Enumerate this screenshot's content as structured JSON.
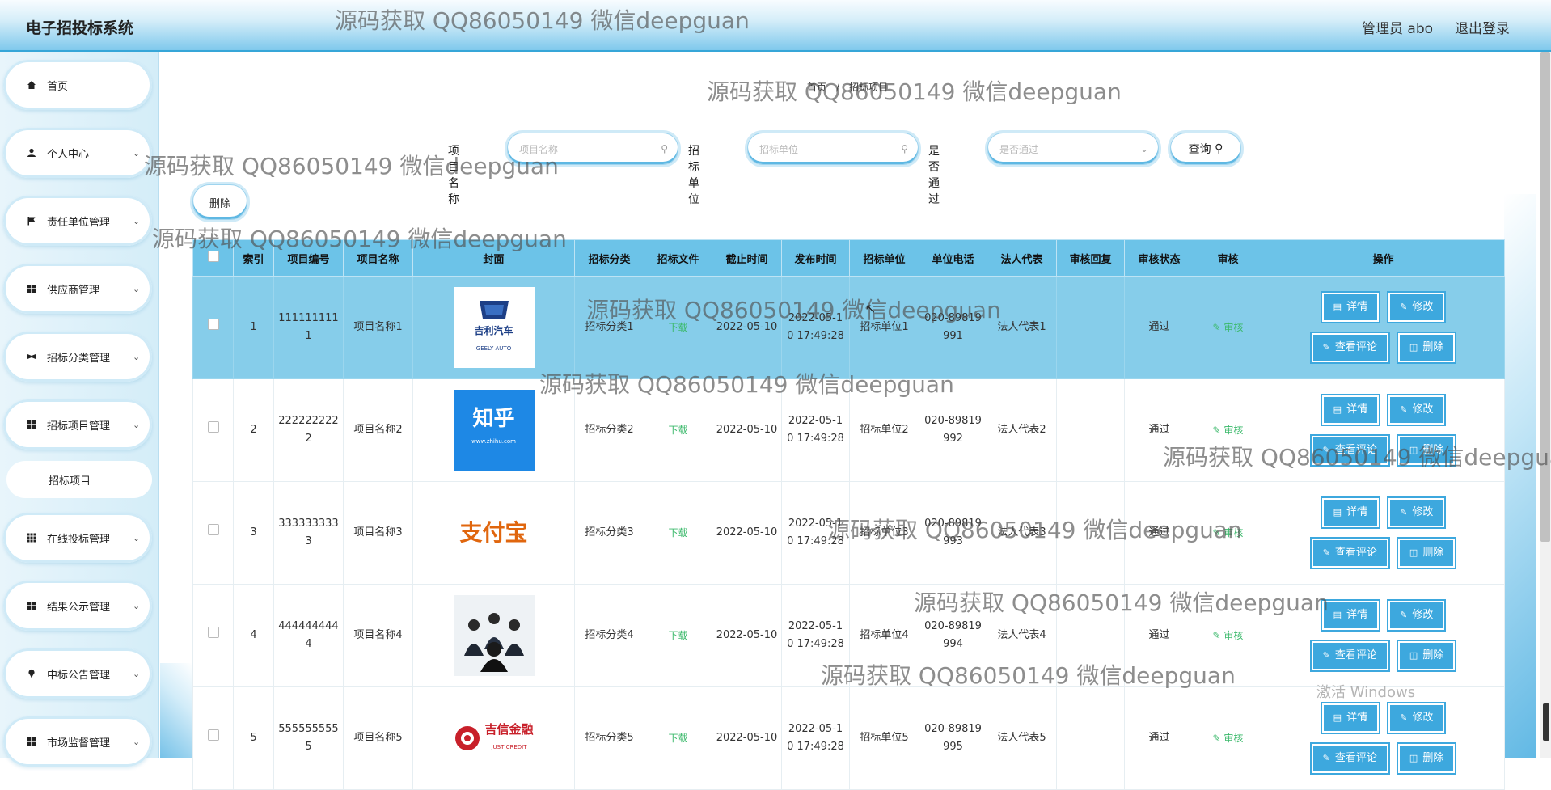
{
  "header": {
    "app_title": "电子招投标系统",
    "admin_text": "管理员 abo",
    "logout_label": "退出登录"
  },
  "sidebar": {
    "items": [
      {
        "label": "首页",
        "icon": "home-icon",
        "has_chevron": false
      },
      {
        "label": "个人中心",
        "icon": "user-icon",
        "has_chevron": true
      },
      {
        "label": "责任单位管理",
        "icon": "flag-icon",
        "has_chevron": true
      },
      {
        "label": "供应商管理",
        "icon": "grid-icon",
        "has_chevron": true
      },
      {
        "label": "招标分类管理",
        "icon": "ribbon-icon",
        "has_chevron": true
      },
      {
        "label": "招标项目管理",
        "icon": "grid-icon",
        "has_chevron": true
      },
      {
        "label": "在线投标管理",
        "icon": "apps-icon",
        "has_chevron": true
      },
      {
        "label": "结果公示管理",
        "icon": "grid-icon",
        "has_chevron": true
      },
      {
        "label": "中标公告管理",
        "icon": "pin-icon",
        "has_chevron": true
      },
      {
        "label": "市场监督管理",
        "icon": "grid-icon",
        "has_chevron": true
      }
    ],
    "sub_item": {
      "label": "招标项目"
    }
  },
  "breadcrumb": {
    "home": "首页",
    "sep": "/",
    "current": "招标项目"
  },
  "search": {
    "name_label": "项目名称",
    "name_placeholder": "项目名称",
    "unit_label": "招标单位",
    "unit_placeholder": "招标单位",
    "pass_label": "是否通过",
    "pass_placeholder": "是否通过",
    "query_label": "查询"
  },
  "toolbar": {
    "delete_label": "删除"
  },
  "table": {
    "headers": [
      "",
      "索引",
      "项目编号",
      "项目名称",
      "封面",
      "招标分类",
      "招标文件",
      "截止时间",
      "发布时间",
      "招标单位",
      "单位电话",
      "法人代表",
      "审核回复",
      "审核状态",
      "审核",
      "操作"
    ],
    "rows": [
      {
        "index": "1",
        "code": "1111111111",
        "name": "项目名称1",
        "cover": "吉利汽车",
        "cover_sub": "GEELY AUTO",
        "category": "招标分类1",
        "file": "下载",
        "deadline": "2022-05-10",
        "publish": "2022-05-10 17:49:28",
        "unit": "招标单位1",
        "phone": "020-89819991",
        "legal": "法人代表1",
        "reply": "",
        "status": "通过",
        "audit": "审核"
      },
      {
        "index": "2",
        "code": "2222222222",
        "name": "项目名称2",
        "cover": "知乎",
        "cover_sub": "www.zhihu.com",
        "category": "招标分类2",
        "file": "下载",
        "deadline": "2022-05-10",
        "publish": "2022-05-10 17:49:28",
        "unit": "招标单位2",
        "phone": "020-89819992",
        "legal": "法人代表2",
        "reply": "",
        "status": "通过",
        "audit": "审核"
      },
      {
        "index": "3",
        "code": "3333333333",
        "name": "项目名称3",
        "cover": "支付宝",
        "cover_sub": "",
        "category": "招标分类3",
        "file": "下载",
        "deadline": "2022-05-10",
        "publish": "2022-05-10 17:49:28",
        "unit": "招标单位3",
        "phone": "020-89819993",
        "legal": "法人代表3",
        "reply": "",
        "status": "通过",
        "audit": "审核"
      },
      {
        "index": "4",
        "code": "4444444444",
        "name": "项目名称4",
        "cover": "",
        "cover_sub": "",
        "category": "招标分类4",
        "file": "下载",
        "deadline": "2022-05-10",
        "publish": "2022-05-10 17:49:28",
        "unit": "招标单位4",
        "phone": "020-89819994",
        "legal": "法人代表4",
        "reply": "",
        "status": "通过",
        "audit": "审核"
      },
      {
        "index": "5",
        "code": "5555555555",
        "name": "项目名称5",
        "cover": "吉信金融",
        "cover_sub": "JUST CREDIT",
        "category": "招标分类5",
        "file": "下载",
        "deadline": "2022-05-10",
        "publish": "2022-05-10 17:49:28",
        "unit": "招标单位5",
        "phone": "020-89819995",
        "legal": "法人代表5",
        "reply": "",
        "status": "通过",
        "audit": "审核"
      }
    ],
    "actions": {
      "detail": "详情",
      "edit": "修改",
      "comments": "查看评论",
      "delete": "删除"
    }
  },
  "watermark": "源码获取 QQ86050149 微信deepguan",
  "os_overlay": {
    "activate": "激活 Windows"
  },
  "colors": {
    "accent": "#3da8de",
    "header_bottom": "#7fc9ec",
    "selected_row": "#86cdea",
    "link_green": "#3bb96b"
  }
}
